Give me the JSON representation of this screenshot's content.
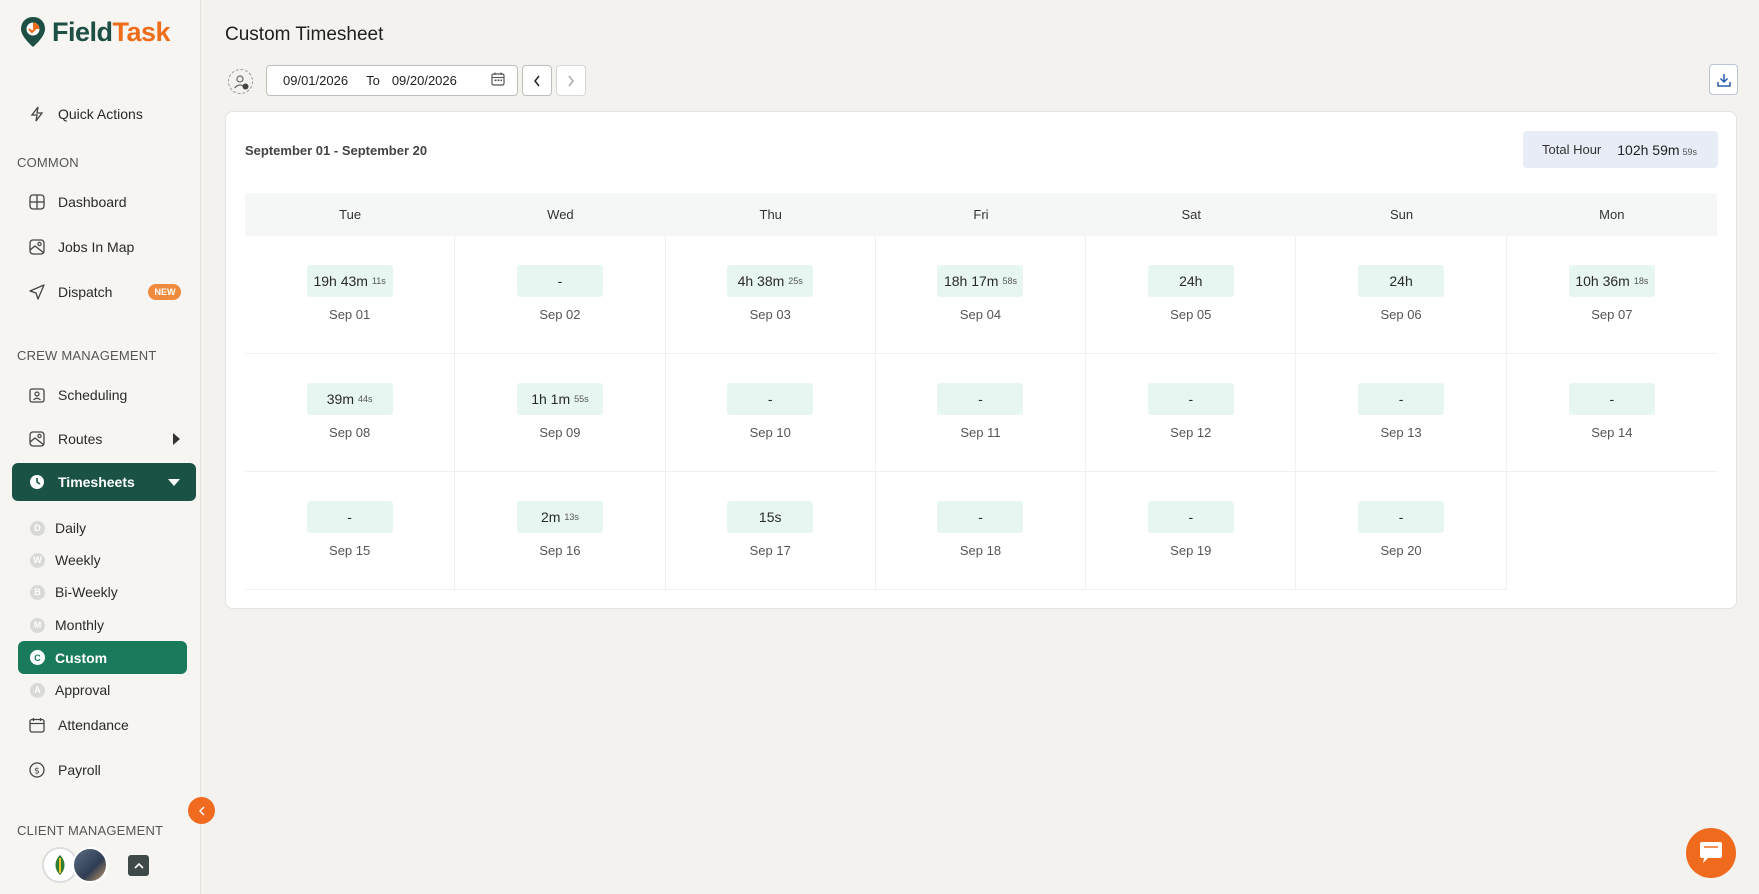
{
  "app": {
    "brand_part1": "Field",
    "brand_part2": "Task"
  },
  "sidebar": {
    "quick_actions": "Quick Actions",
    "section_common": "COMMON",
    "dashboard": "Dashboard",
    "jobs_in_map": "Jobs In Map",
    "dispatch": "Dispatch",
    "dispatch_badge": "NEW",
    "section_crew": "CREW MANAGEMENT",
    "scheduling": "Scheduling",
    "routes": "Routes",
    "timesheets": "Timesheets",
    "sub": [
      {
        "letter": "D",
        "label": "Daily"
      },
      {
        "letter": "W",
        "label": "Weekly"
      },
      {
        "letter": "B",
        "label": "Bi-Weekly"
      },
      {
        "letter": "M",
        "label": "Monthly"
      },
      {
        "letter": "C",
        "label": "Custom"
      },
      {
        "letter": "A",
        "label": "Approval"
      }
    ],
    "attendance": "Attendance",
    "payroll": "Payroll",
    "section_client": "CLIENT MANAGEMENT"
  },
  "header": {
    "title": "Custom Timesheet",
    "from_date": "09/01/2026",
    "to_label": "To",
    "to_date": "09/20/2026"
  },
  "panel": {
    "range": "September 01 - September 20",
    "total_label": "Total Hour",
    "total_value": "102h 59m",
    "total_seconds": "59s"
  },
  "weekdays": [
    "Tue",
    "Wed",
    "Thu",
    "Fri",
    "Sat",
    "Sun",
    "Mon"
  ],
  "days": [
    {
      "main": "19h 43m",
      "sec": "11s",
      "date": "Sep 01"
    },
    {
      "main": "-",
      "sec": "",
      "date": "Sep 02"
    },
    {
      "main": "4h 38m",
      "sec": "25s",
      "date": "Sep 03"
    },
    {
      "main": "18h 17m",
      "sec": "58s",
      "date": "Sep 04"
    },
    {
      "main": "24h",
      "sec": "",
      "date": "Sep 05"
    },
    {
      "main": "24h",
      "sec": "",
      "date": "Sep 06"
    },
    {
      "main": "10h 36m",
      "sec": "18s",
      "date": "Sep 07"
    },
    {
      "main": "39m",
      "sec": "44s",
      "date": "Sep 08"
    },
    {
      "main": "1h 1m",
      "sec": "55s",
      "date": "Sep 09"
    },
    {
      "main": "-",
      "sec": "",
      "date": "Sep 10"
    },
    {
      "main": "-",
      "sec": "",
      "date": "Sep 11"
    },
    {
      "main": "-",
      "sec": "",
      "date": "Sep 12"
    },
    {
      "main": "-",
      "sec": "",
      "date": "Sep 13"
    },
    {
      "main": "-",
      "sec": "",
      "date": "Sep 14"
    },
    {
      "main": "-",
      "sec": "",
      "date": "Sep 15"
    },
    {
      "main": "2m",
      "sec": "13s",
      "date": "Sep 16"
    },
    {
      "main": "15s",
      "sec": "",
      "date": "Sep 17"
    },
    {
      "main": "-",
      "sec": "",
      "date": "Sep 18"
    },
    {
      "main": "-",
      "sec": "",
      "date": "Sep 19"
    },
    {
      "main": "-",
      "sec": "",
      "date": "Sep 20"
    }
  ],
  "colors": {
    "primary": "#1a5346",
    "accent": "#ef6c1a",
    "active_sub": "#1a7a5c",
    "pill_bg": "#e7f6f1"
  }
}
